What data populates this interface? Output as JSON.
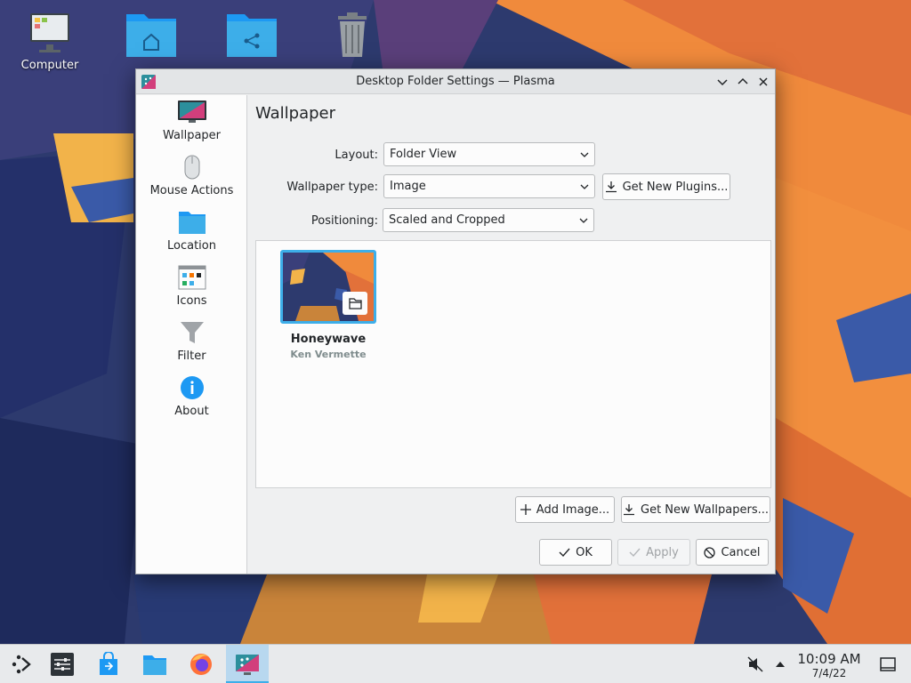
{
  "desktop": {
    "icons": [
      {
        "label": "Computer",
        "icon": "computer-icon"
      },
      {
        "label": "",
        "icon": "home-folder-icon"
      },
      {
        "label": "",
        "icon": "network-folder-icon"
      },
      {
        "label": "",
        "icon": "trash-icon"
      }
    ]
  },
  "dialog": {
    "title": "Desktop Folder Settings — Plasma",
    "sidebar": [
      {
        "label": "Wallpaper",
        "icon": "monitor-icon",
        "selected": true
      },
      {
        "label": "Mouse Actions",
        "icon": "mouse-icon"
      },
      {
        "label": "Location",
        "icon": "folder-icon"
      },
      {
        "label": "Icons",
        "icon": "icons-grid-icon"
      },
      {
        "label": "Filter",
        "icon": "filter-funnel-icon"
      },
      {
        "label": "About",
        "icon": "info-icon"
      }
    ],
    "page_title": "Wallpaper",
    "layout": {
      "label": "Layout:",
      "value": "Folder View"
    },
    "wallpaper_type": {
      "label": "Wallpaper type:",
      "value": "Image"
    },
    "get_plugins_label": "Get New Plugins...",
    "positioning": {
      "label": "Positioning:",
      "value": "Scaled and Cropped"
    },
    "wallpapers": [
      {
        "name": "Honeywave",
        "author": "Ken Vermette"
      }
    ],
    "add_image_label": "Add Image...",
    "get_wallpapers_label": "Get New Wallpapers...",
    "ok_label": "OK",
    "apply_label": "Apply",
    "cancel_label": "Cancel"
  },
  "taskbar": {
    "time": "10:09 AM",
    "date": "7/4/22",
    "apps": [
      "application-launcher-icon",
      "system-settings-icon",
      "discover-icon",
      "dolphin-icon",
      "firefox-icon",
      "desktop-settings-icon"
    ]
  },
  "colors": {
    "accent": "#3daee9",
    "window_bg": "#eff0f1",
    "sidebar_bg": "#fcfcfc"
  }
}
